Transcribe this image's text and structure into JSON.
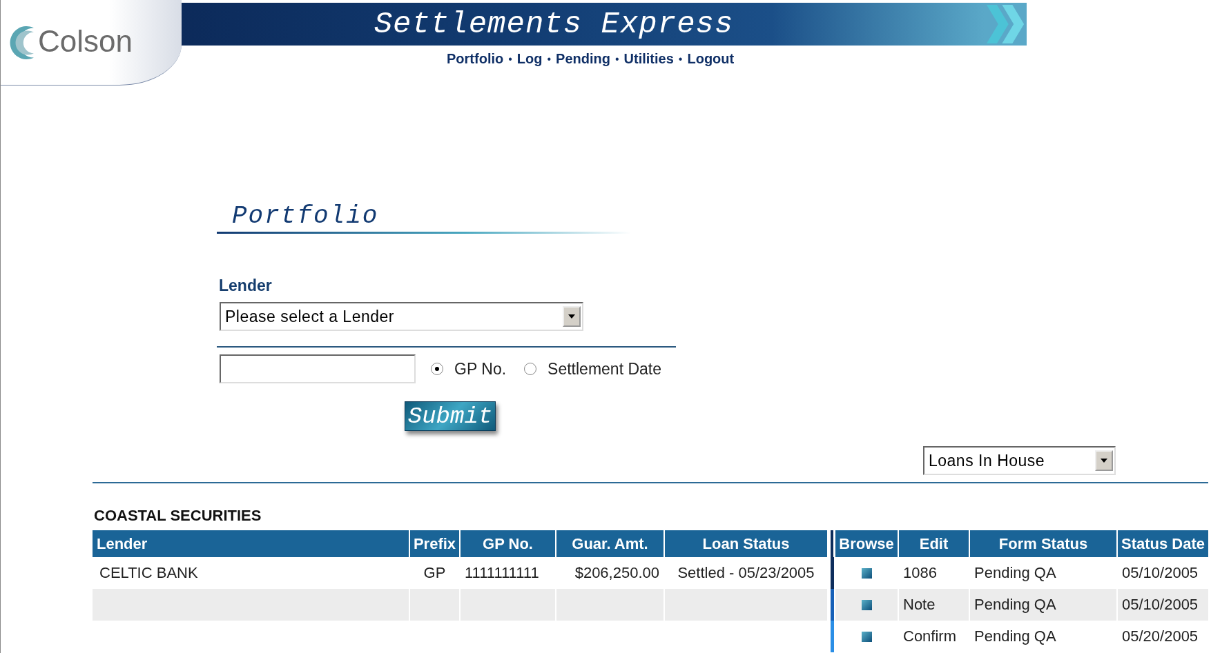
{
  "header": {
    "logo": "Colson",
    "title": "Settlements Express",
    "nav": [
      {
        "kind": "link",
        "text": "Portfolio"
      },
      {
        "kind": "separator",
        "text": "•"
      },
      {
        "kind": "link",
        "text": "Log"
      },
      {
        "kind": "separator",
        "text": "•"
      },
      {
        "kind": "link",
        "text": "Pending"
      },
      {
        "kind": "separator",
        "text": "•"
      },
      {
        "kind": "link",
        "text": "Utilities"
      },
      {
        "kind": "separator",
        "text": "•"
      },
      {
        "kind": "link",
        "text": "Logout"
      }
    ]
  },
  "page_title": "Portfolio",
  "lender": {
    "label": "Lender",
    "select": "Please select a Lender"
  },
  "search": {
    "options": [
      {
        "label": "GP No.",
        "selected": true
      },
      {
        "label": "Settlement Date",
        "selected": false
      }
    ],
    "submit": "Submit"
  },
  "view_select": "Loans In House",
  "section_title": "COASTAL SECURITIES",
  "table": {
    "columns": [
      "Lender",
      "Prefix",
      "GP No.",
      "Guar. Amt.",
      "Loan Status",
      "Browse",
      "Edit",
      "Form Status",
      "Status Date"
    ],
    "rows": [
      {
        "lender": "CELTIC BANK",
        "prefix": "GP",
        "gp_no": "1111111111",
        "guar_amt": "$206,250.00",
        "loan_status": "Settled - 05/23/2005",
        "edit": "1086",
        "form_status": "Pending QA",
        "status_date": "05/10/2005"
      },
      {
        "edit": "Note",
        "form_status": "Pending QA",
        "status_date": "05/10/2005"
      },
      {
        "edit": "Confirm",
        "form_status": "Pending QA",
        "status_date": "05/20/2005"
      }
    ]
  }
}
